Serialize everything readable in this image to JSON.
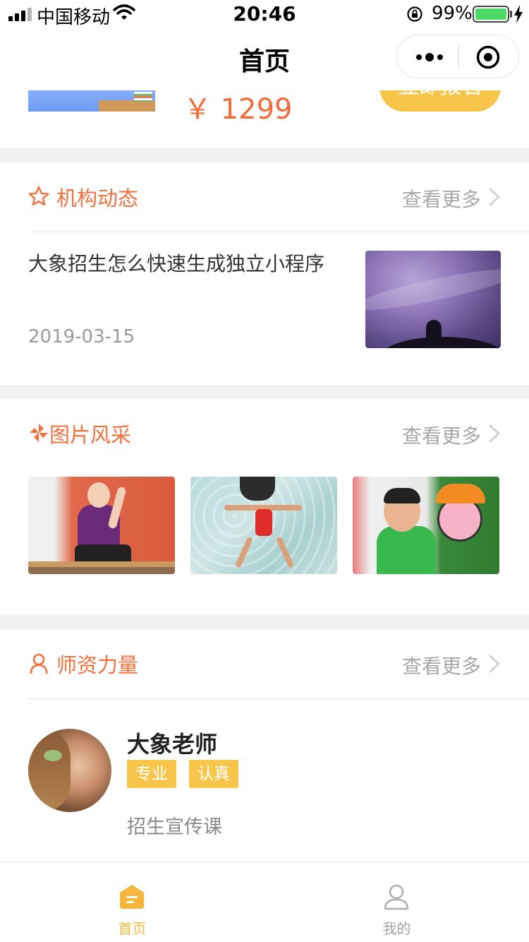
{
  "status_bar": {
    "carrier": "中国移动",
    "time": "20:46",
    "battery_percent": "99%",
    "battery_level": 0.99,
    "icons": [
      "signal-icon",
      "wifi-icon",
      "rotation-lock-icon",
      "battery-icon",
      "charging-icon"
    ]
  },
  "nav": {
    "title": "首页",
    "icons": [
      "more-dots-icon",
      "close-target-icon"
    ]
  },
  "promo": {
    "price": "￥ 1299",
    "button_label": "立即报名"
  },
  "news": {
    "title": "机构动态",
    "more_label": "查看更多",
    "item": {
      "title": "大象招生怎么快速生成独立小程序",
      "date": "2019-03-15"
    }
  },
  "gallery": {
    "title": "图片风采",
    "more_label": "查看更多"
  },
  "teachers": {
    "title": "师资力量",
    "more_label": "查看更多",
    "teacher": {
      "name": "大象老师",
      "tags": [
        "专业",
        "认真"
      ],
      "course": "招生宣传课"
    }
  },
  "tab_bar": {
    "items": [
      {
        "label": "首页",
        "icon": "home-icon",
        "active": true
      },
      {
        "label": "我的",
        "icon": "user-icon",
        "active": false
      }
    ]
  },
  "colors": {
    "accent_orange": "#f2703b",
    "accent_yellow": "#f8c54b",
    "tab_active": "#f5b73b",
    "muted": "#a8a8a8"
  }
}
